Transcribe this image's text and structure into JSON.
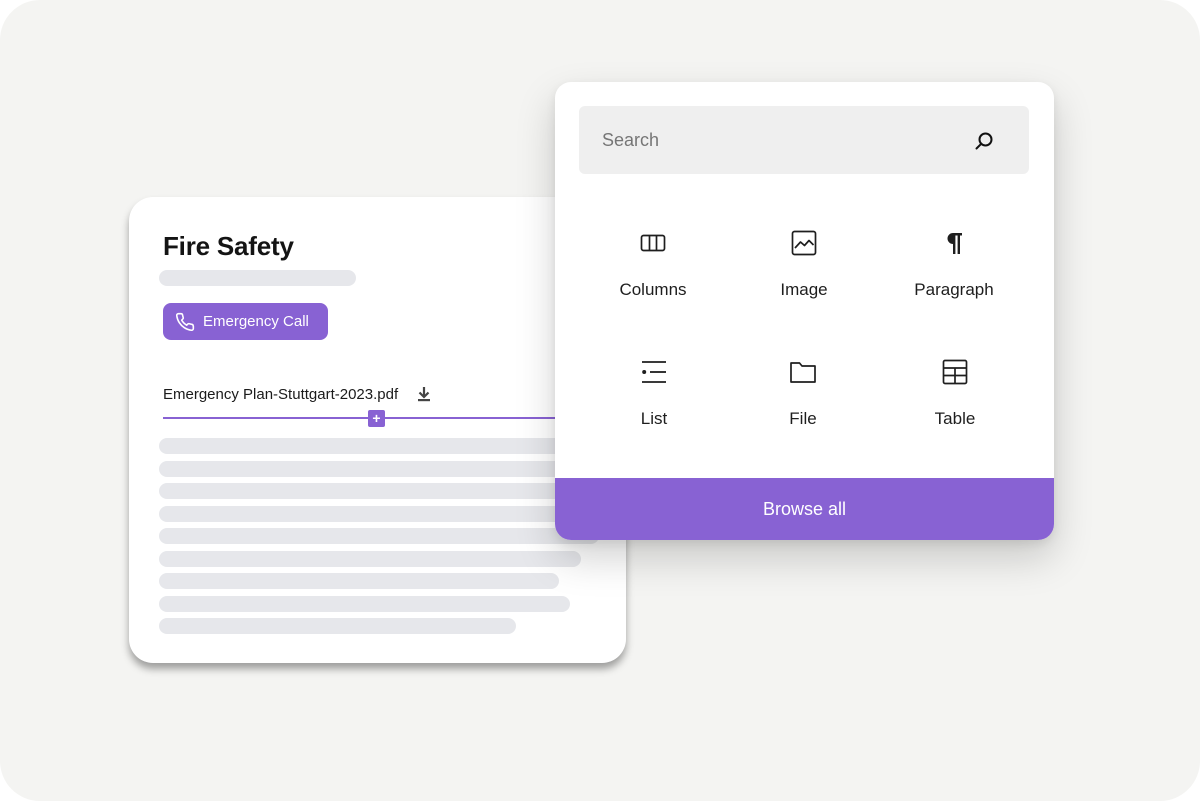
{
  "document": {
    "title": "Fire Safety",
    "emergency_button": {
      "label": "Emergency Call",
      "icon": "phone-icon"
    },
    "attachment": {
      "filename": "Emergency Plan-Stuttgart-2023.pdf",
      "icon": "download-icon"
    },
    "insert_block_icon": "plus-icon"
  },
  "picker": {
    "search": {
      "placeholder": "Search",
      "value": "",
      "icon": "search-icon"
    },
    "blocks": [
      {
        "label": "Columns",
        "icon": "columns-icon"
      },
      {
        "label": "Image",
        "icon": "image-icon"
      },
      {
        "label": "Paragraph",
        "icon": "paragraph-icon"
      },
      {
        "label": "List",
        "icon": "list-icon"
      },
      {
        "label": "File",
        "icon": "folder-icon"
      },
      {
        "label": "Table",
        "icon": "table-icon"
      }
    ],
    "browse_all_label": "Browse all"
  },
  "colors": {
    "accent": "#8862d3",
    "background": "#f4f4f2",
    "skeleton": "#e6e7eb",
    "search_background": "#efefef"
  }
}
